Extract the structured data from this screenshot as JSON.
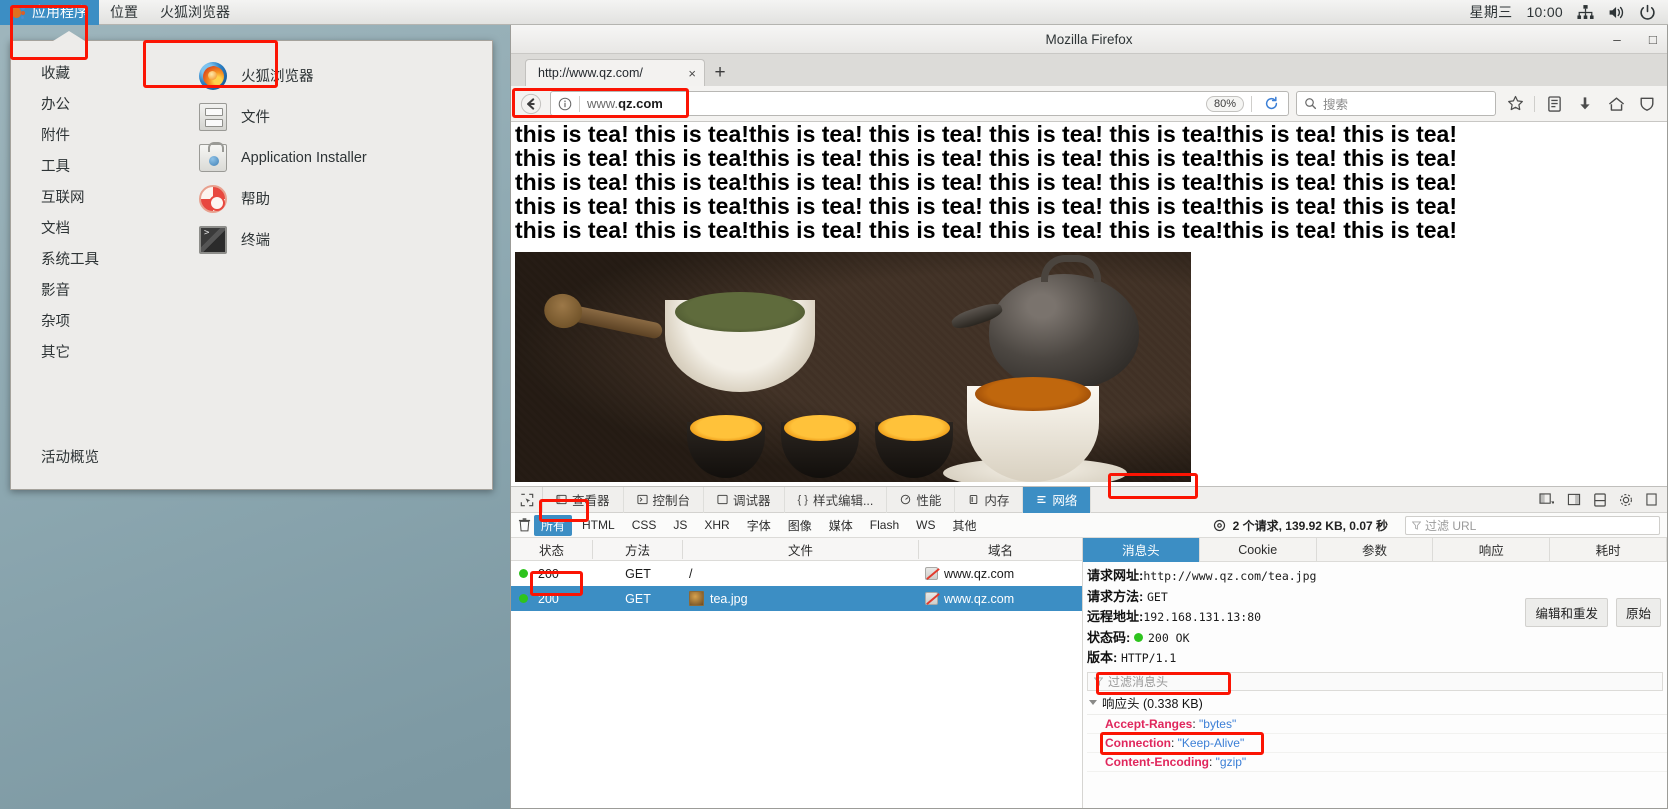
{
  "panel": {
    "menus": [
      {
        "label": "应用程序",
        "icon": "gnome-foot-icon",
        "active": true
      },
      {
        "label": "位置",
        "icon": "",
        "active": false
      },
      {
        "label": "火狐浏览器",
        "icon": "",
        "active": false
      }
    ],
    "tray": {
      "day": "星期三",
      "time": "10:00",
      "icons": [
        "network-icon",
        "volume-icon",
        "power-icon"
      ]
    }
  },
  "appmenu": {
    "categories": [
      "收藏",
      "办公",
      "附件",
      "工具",
      "互联网",
      "文档",
      "系统工具",
      "影音",
      "杂项",
      "其它"
    ],
    "overview_label": "活动概览",
    "apps": [
      {
        "label": "火狐浏览器",
        "icon": "firefox-icon"
      },
      {
        "label": "文件",
        "icon": "file-manager-icon"
      },
      {
        "label": "Application Installer",
        "icon": "application-installer-icon"
      },
      {
        "label": "帮助",
        "icon": "help-icon"
      },
      {
        "label": "终端",
        "icon": "terminal-icon"
      }
    ]
  },
  "browser": {
    "window_title": "Mozilla Firefox",
    "window_buttons": {
      "minimize": "–",
      "maximize": "□"
    },
    "tab": {
      "title": "http://www.qz.com/",
      "close": "×"
    },
    "new_tab_label": "+",
    "urlbar": {
      "prefix": "www.",
      "domain": "qz.com",
      "zoom": "80%",
      "identity_icon": "info-icon",
      "back_icon": "back-arrow-icon",
      "reload_icon": "reload-icon"
    },
    "search": {
      "placeholder": "搜索",
      "icon": "search-icon"
    },
    "toolbar_icons": [
      "bookmark-star-icon",
      "library-icon",
      "downloads-icon",
      "home-icon",
      "shield-icon"
    ],
    "page": {
      "text_line": "this is tea! this is tea!this is tea! this is tea! this is tea! this is tea!this is tea! this is tea!",
      "lines": 5,
      "image_alt": "tea.jpg"
    }
  },
  "devtools": {
    "picker_icon": "element-picker-icon",
    "tabs": [
      {
        "label": "查看器",
        "icon": "inspector-icon",
        "selected": false
      },
      {
        "label": "控制台",
        "icon": "console-icon",
        "selected": false
      },
      {
        "label": "调试器",
        "icon": "debugger-icon",
        "selected": false
      },
      {
        "label": "样式编辑...",
        "icon": "style-editor-icon",
        "selected": false
      },
      {
        "label": "性能",
        "icon": "performance-icon",
        "selected": false
      },
      {
        "label": "内存",
        "icon": "memory-icon",
        "selected": false
      },
      {
        "label": "网络",
        "icon": "network-icon",
        "selected": true
      }
    ],
    "tools_icons": [
      "layout-toggle-icon",
      "dock-side-icon",
      "responsive-design-icon",
      "settings-gear-icon",
      "close-panel-icon"
    ],
    "filters": [
      {
        "label": "所有",
        "selected": true
      },
      {
        "label": "HTML",
        "selected": false
      },
      {
        "label": "CSS",
        "selected": false
      },
      {
        "label": "JS",
        "selected": false
      },
      {
        "label": "XHR",
        "selected": false
      },
      {
        "label": "字体",
        "selected": false
      },
      {
        "label": "图像",
        "selected": false
      },
      {
        "label": "媒体",
        "selected": false
      },
      {
        "label": "Flash",
        "selected": false
      },
      {
        "label": "WS",
        "selected": false
      },
      {
        "label": "其他",
        "selected": false
      }
    ],
    "trash_icon": "trash-icon",
    "summary": "2 个请求, 139.92 KB, 0.07 秒",
    "url_filter_placeholder": "过滤 URL",
    "table": {
      "columns": [
        "状态",
        "方法",
        "文件",
        "域名"
      ],
      "rows": [
        {
          "status": "200",
          "method": "GET",
          "file": "/",
          "domain": "www.qz.com",
          "selected": false,
          "has_thumb": false
        },
        {
          "status": "200",
          "method": "GET",
          "file": "tea.jpg",
          "domain": "www.qz.com",
          "selected": true,
          "has_thumb": true
        }
      ]
    },
    "detail": {
      "tabs": [
        {
          "label": "消息头",
          "selected": true
        },
        {
          "label": "Cookie",
          "selected": false
        },
        {
          "label": "参数",
          "selected": false
        },
        {
          "label": "响应",
          "selected": false
        },
        {
          "label": "耗时",
          "selected": false
        }
      ],
      "fields": [
        {
          "key": "请求网址",
          "sep": ":",
          "value": "http://www.qz.com/tea.jpg"
        },
        {
          "key": "请求方法",
          "sep": ": ",
          "value": "GET"
        },
        {
          "key": "远程地址",
          "sep": ":",
          "value": "192.168.131.13:80"
        },
        {
          "key": "状态码",
          "sep": ": ",
          "value": "200 OK",
          "has_dot": true
        },
        {
          "key": "版本",
          "sep": ": ",
          "value": "HTTP/1.1"
        }
      ],
      "actions": [
        "编辑和重发",
        "原始"
      ],
      "header_filter_placeholder": "过滤消息头",
      "group_label": "响应头 (0.338 KB)",
      "headers": [
        {
          "name": "Accept-Ranges",
          "value": "\"bytes\""
        },
        {
          "name": "Connection",
          "value": "\"Keep-Alive\""
        },
        {
          "name": "Content-Encoding",
          "value": "\"gzip\""
        }
      ]
    }
  },
  "colors": {
    "accent": "#3c8ec4",
    "annotation": "#fb1403",
    "status_ok": "#2ec41e",
    "header_name": "#e0265c",
    "header_value": "#3b7fd6"
  }
}
